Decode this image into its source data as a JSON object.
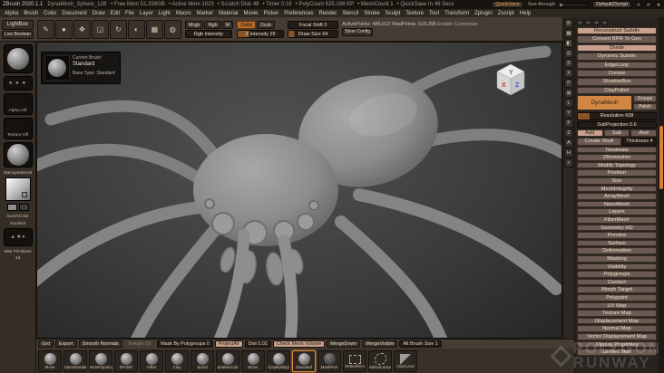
{
  "title_bar": {
    "app": "ZBrush 2020.1.1",
    "tool": "DynaMesh_Sphere_128",
    "stats": [
      "Free Mem 51,339GB",
      "Active Mem 1023",
      "Scratch Disk 48",
      "Timer 0:16",
      "PolyCount 625.198 KP",
      "MeshCount 1",
      "QuickSave In 46 Secs"
    ],
    "quicksave": "QuickSave",
    "see_through": "See-through",
    "default_zscript": "DefaultZScript",
    "win_min": "–",
    "win_max": "□",
    "win_close": "✕"
  },
  "menus": [
    "Alpha",
    "Brush",
    "Color",
    "Document",
    "Draw",
    "Edit",
    "File",
    "Layer",
    "Light",
    "Macro",
    "Marker",
    "Material",
    "Movie",
    "Picker",
    "Preferences",
    "Render",
    "Stencil",
    "Stroke",
    "Sculpt",
    "Texture",
    "Tool",
    "Transform",
    "Zplugin",
    "Zscript",
    "Help"
  ],
  "toolbar": {
    "lightbox": "LightBox",
    "live_boolean": "Live Boolean",
    "icons": [
      {
        "name": "edit-icon",
        "glyph": "✎"
      },
      {
        "name": "draw-icon",
        "glyph": "●"
      },
      {
        "name": "move-icon",
        "glyph": "✥"
      },
      {
        "name": "scale-icon",
        "glyph": "◲"
      },
      {
        "name": "rotate-icon",
        "glyph": "↻"
      },
      {
        "name": "paint-icon",
        "glyph": "◐"
      },
      {
        "name": "wireframe-icon",
        "glyph": "▦"
      },
      {
        "name": "material-icon",
        "glyph": "◍"
      }
    ],
    "mrgb": "Mrgb",
    "rgb": "Rgb",
    "m": "M",
    "zadd": "Zadd",
    "zsub": "Zsub",
    "rgb_intensity": "Rgb Intensity",
    "z_intensity": "Z Intensity 25",
    "focal_shift": "Focal Shift 0",
    "draw_size": "Draw Size 64",
    "active_points": "ActivePoints: 486,012",
    "total_points": "TotalPoints: 616,395",
    "enable_customize": "Enable Customize",
    "store_config": "Store Config"
  },
  "sidebar": {
    "stroke_dots": "● ● ●",
    "alpha": "Alpha Off",
    "texture": "Texture Off",
    "material": "MatcapMaterial",
    "switch_color": "SwitchColor",
    "gradient": "Gradient",
    "imm": "IMM Primitives",
    "imm_count": "14",
    "imm_glyphs": "▲ ■ ●"
  },
  "tooltip": {
    "line1": "Current Brush:",
    "name": "Standard",
    "line2": "Base Type: Standard"
  },
  "camview": {
    "x": "X",
    "y": "Y",
    "z": "Z"
  },
  "canvas_controls": [
    {
      "name": "bpr-icon",
      "glyph": "B"
    },
    {
      "name": "polyframe-icon",
      "glyph": "▦"
    },
    {
      "name": "transparent-icon",
      "glyph": "◧"
    },
    {
      "name": "ghost-icon",
      "glyph": "◎"
    },
    {
      "name": "solo-icon",
      "glyph": "S"
    },
    {
      "name": "xpose-icon",
      "glyph": "X"
    },
    {
      "name": "persp-icon",
      "glyph": "P"
    },
    {
      "name": "floor-icon",
      "glyph": "⊞"
    },
    {
      "name": "local-icon",
      "glyph": "L"
    },
    {
      "name": "lsym-icon",
      "glyph": "Y"
    },
    {
      "name": "frame-icon",
      "glyph": "F"
    },
    {
      "name": "zoom-icon",
      "glyph": "Z"
    },
    {
      "name": "actual-icon",
      "glyph": "A"
    },
    {
      "name": "aahalf-icon",
      "glyph": "H"
    },
    {
      "name": "scroll-icon",
      "glyph": "+"
    }
  ],
  "right_panel": {
    "items_top": [
      {
        "label": "Reconstruct Subdiv",
        "style": "light"
      },
      {
        "label": "Convert BPR To Geo",
        "style": ""
      },
      {
        "label": "Divide",
        "style": "light"
      },
      {
        "label": "Dynamic Subdiv",
        "style": ""
      },
      {
        "label": "EdgeLoop",
        "style": ""
      },
      {
        "label": "Crease",
        "style": ""
      },
      {
        "label": "ShadowBox",
        "style": ""
      },
      {
        "label": "ClayPolish",
        "style": ""
      }
    ],
    "dynamesh": {
      "title": "DynaMesh",
      "groups": "Groups",
      "polish": "Polish",
      "resolution": "Resolution 608",
      "subprojection": "SubProjection 0.6",
      "add": "Add",
      "sub": "Sub",
      "and": "And",
      "create_shell": "Create Shell",
      "thickness": "Thickness 4"
    },
    "items_bottom": [
      "Tessimate",
      "ZRemesher",
      "Modify Topology",
      "Position",
      "Size",
      "MeshIntegrity",
      "ArrayMesh",
      "NanoMesh",
      "Layers",
      "FiberMesh",
      "Geometry HD",
      "Preview",
      "Surface",
      "Deformation",
      "Masking",
      "Visibility",
      "Polygroups",
      "Contact",
      "Morph Target",
      "Polypaint",
      "UV Map",
      "Texture Map",
      "Displacement Map",
      "Normal Map",
      "Vector Displacement Map",
      "Display Properties",
      "Unified Skin"
    ]
  },
  "bottom_bar": {
    "grd": "Grd",
    "export": "Export",
    "smooth_normals": "Smooth Normals",
    "texture_on": "Texture On",
    "mask_by_polygroups": "Mask By Polygroups 0",
    "project_all": "ProjectAll",
    "dist": "Dist 0.02",
    "check_mesh_volume": "Check Mesh Volume",
    "merge_down": "MergeDown",
    "merge_visible": "MergeVisible",
    "alt_brush_size": "Alt Brush Size 1"
  },
  "tray": {
    "brushes": [
      {
        "label": "Move",
        "style": ""
      },
      {
        "label": "DamStandard",
        "style": ""
      },
      {
        "label": "MoveTopological",
        "style": ""
      },
      {
        "label": "hPolish",
        "style": ""
      },
      {
        "label": "Inflat",
        "style": ""
      },
      {
        "label": "Clay",
        "style": ""
      },
      {
        "label": "Spiral",
        "style": ""
      },
      {
        "label": "SnakeHook",
        "style": ""
      },
      {
        "label": "Move",
        "style": ""
      },
      {
        "label": "ClayBuildup",
        "style": ""
      },
      {
        "label": "Standard",
        "style": "sel"
      },
      {
        "label": "MaskPen",
        "style": "dark"
      },
      {
        "label": "SelectRect",
        "style": "rect"
      },
      {
        "label": "SelectLasso",
        "style": "lasso"
      },
      {
        "label": "ClipCurve",
        "style": "clip"
      }
    ]
  },
  "watermark": {
    "line1": "POLYGON",
    "line2": "RUNWAY"
  }
}
